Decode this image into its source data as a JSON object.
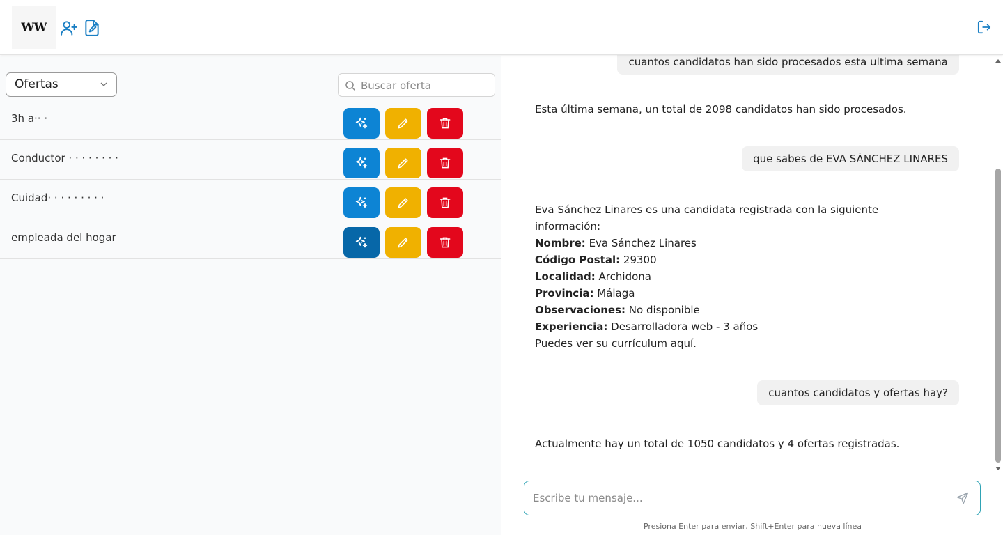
{
  "header": {
    "logo_text": "WW",
    "icons": [
      "add-user-icon",
      "edit-document-icon",
      "logout-icon"
    ]
  },
  "offers_panel": {
    "select_value": "Ofertas",
    "search_placeholder": "Buscar oferta",
    "offers": [
      {
        "title": "3h a·· ·"
      },
      {
        "title": "Conductor ·  ·  ·  ·  ·  ·  ·  ·"
      },
      {
        "title": "Cuidad· ·  ·  ·  ·  ·  ·  ·  ·"
      },
      {
        "title": "empleada del hogar"
      }
    ]
  },
  "chat": {
    "messages": [
      {
        "role": "user",
        "text": "cuantos candidatos han sido procesados esta ultima semana"
      },
      {
        "role": "bot",
        "text": "Esta última semana, un total de 2098 candidatos han sido procesados."
      },
      {
        "role": "user",
        "text": "que sabes de EVA SÁNCHEZ LINARES"
      },
      {
        "role": "bot",
        "intro": "Eva Sánchez Linares es una candidata registrada con la siguiente información:",
        "fields": [
          {
            "label": "Nombre:",
            "value": "Eva Sánchez Linares"
          },
          {
            "label": "Código Postal:",
            "value": "29300"
          },
          {
            "label": "Localidad:",
            "value": "Archidona"
          },
          {
            "label": "Provincia:",
            "value": "Málaga"
          },
          {
            "label": "Observaciones:",
            "value": "No disponible"
          },
          {
            "label": "Experiencia:",
            "value": "Desarrolladora web - 3 años"
          }
        ],
        "cv_prefix": "Puedes ver su currículum ",
        "cv_link": "aquí",
        "cv_suffix": "."
      },
      {
        "role": "user",
        "text": "cuantos candidatos y ofertas hay?"
      },
      {
        "role": "bot",
        "text": "Actualmente hay un total de 1050 candidatos y 4 ofertas registradas."
      }
    ],
    "input_placeholder": "Escribe tu mensaje...",
    "hint": "Presiona Enter para enviar, Shift+Enter para nueva línea"
  },
  "colors": {
    "primary_blue": "#0d84d4",
    "edit_yellow": "#f0b100",
    "delete_red": "#e3071c",
    "input_border": "#2fa3b5"
  }
}
